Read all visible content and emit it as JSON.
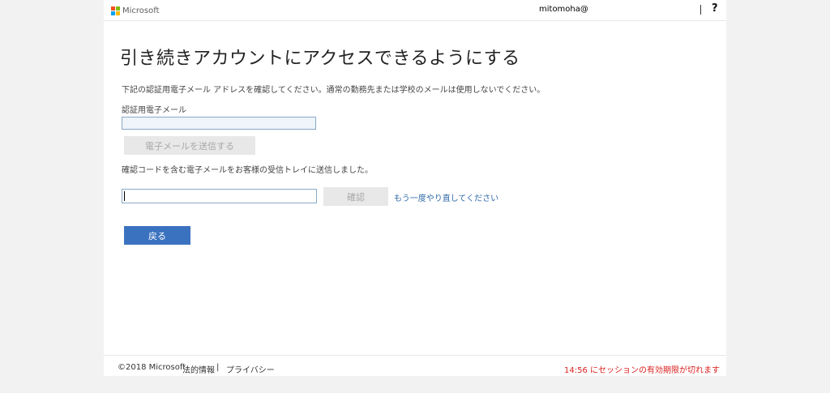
{
  "header": {
    "brand": "Microsoft",
    "user_name": "mitomoha@",
    "help_label": "?",
    "logo_colors": [
      "#f25022",
      "#7fba00",
      "#00a4ef",
      "#ffb900"
    ]
  },
  "main": {
    "title": "引き続きアカウントにアクセスできるようにする",
    "description": "下記の認証用電子メール アドレスを確認してください。通常の勤務先または学校のメールは使用しないでください。",
    "email_label": "認証用電子メール",
    "email_value": "",
    "send_button": "電子メールを送信する",
    "sent_message": "確認コードを含む電子メールをお客様の受信トレイに送信しました。",
    "code_value": "",
    "confirm_button": "確認",
    "retry_link": "もう一度やり直してください",
    "back_button": "戻る"
  },
  "footer": {
    "copyright": "©2018 Microsoft",
    "legal": "法的情報",
    "separator": "|",
    "privacy": "プライバシー",
    "session_expiry": "14:56 にセッションの有効期限が切れます"
  },
  "colors": {
    "accent": "#3b72c0",
    "link": "#2f6aa8",
    "warning": "#d9201e"
  }
}
